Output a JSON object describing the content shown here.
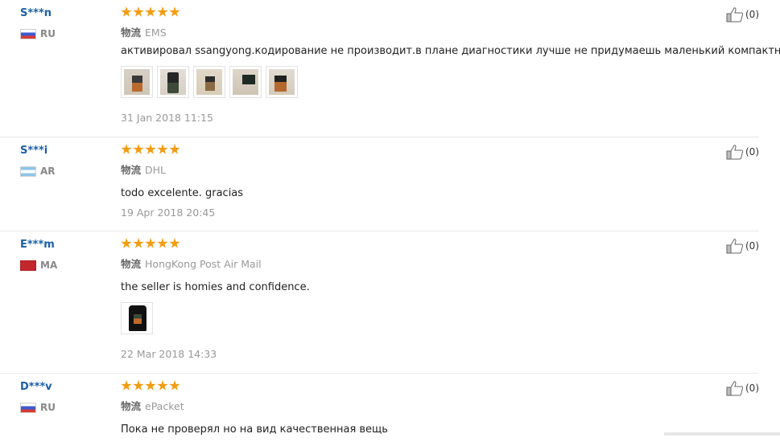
{
  "reviews": [
    {
      "user": "S***n",
      "country": "RU",
      "logistics_label": "物流",
      "logistics": "EMS",
      "text": "активировал ssangyong.кодирование не производит.в плане диагностики лучше не придумаешь маленький компактный",
      "date": "31 Jan 2018 11:15",
      "likes": "(0)",
      "rating": 5,
      "photos": 5
    },
    {
      "user": "S***i",
      "country": "AR",
      "logistics_label": "物流",
      "logistics": "DHL",
      "text": "todo excelente. gracias",
      "date": "19 Apr 2018 20:45",
      "likes": "(0)",
      "rating": 5,
      "photos": 0
    },
    {
      "user": "E***m",
      "country": "MA",
      "logistics_label": "物流",
      "logistics": "HongKong Post Air Mail",
      "text": "the seller is homies and confidence.",
      "date": "22 Mar 2018 14:33",
      "likes": "(0)",
      "rating": 5,
      "photos": 1
    },
    {
      "user": "D***v",
      "country": "RU",
      "logistics_label": "物流",
      "logistics": "ePacket",
      "text": "Пока не проверял но на вид качественная вещь",
      "likes": "(0)",
      "rating": 5,
      "photos": 0
    }
  ],
  "icons": {
    "star": "star-icon",
    "like": "thumbs-up-icon"
  },
  "colors": {
    "username": "#1a5fa8",
    "star": "#f39c12",
    "muted": "#999999"
  }
}
